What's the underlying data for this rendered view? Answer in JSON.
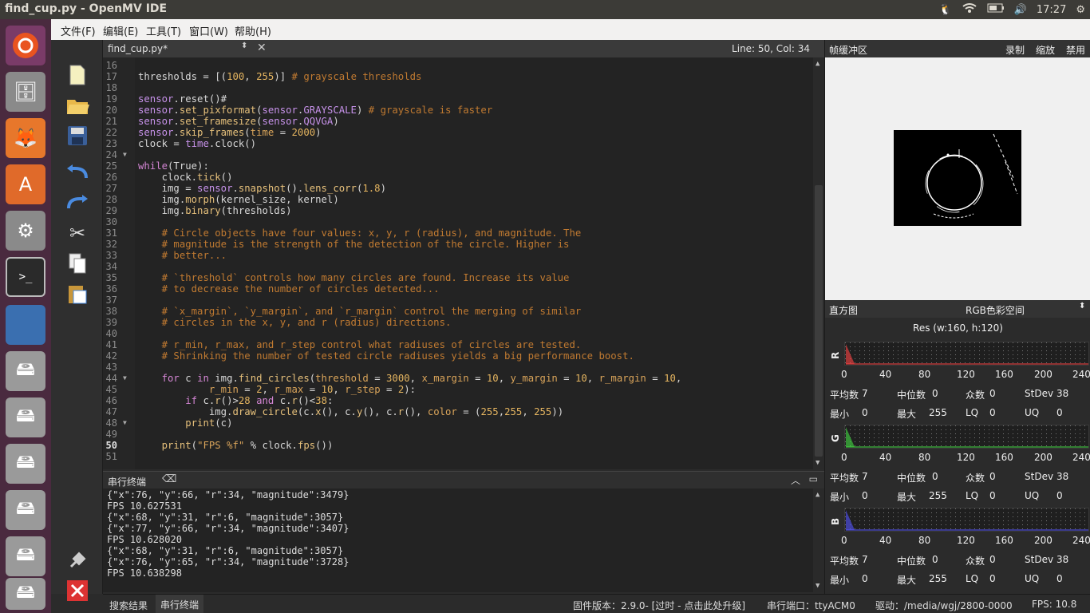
{
  "window": {
    "title": "find_cup.py - OpenMV IDE",
    "time": "17:27"
  },
  "menu": [
    "文件(F)",
    "编辑(E)",
    "工具(T)",
    "窗口(W)",
    "帮助(H)"
  ],
  "editor": {
    "tab": "find_cup.py*",
    "position": "Line: 50, Col: 34",
    "lines": [
      {
        "n": "16",
        "html": ""
      },
      {
        "n": "17",
        "html": "thresholds = [(<span class='num'>100</span>, <span class='num'>255</span>)] <span class='cm'># grayscale thresholds</span>"
      },
      {
        "n": "18",
        "html": ""
      },
      {
        "n": "19",
        "html": "<span class='nm'>sensor</span>.reset()#"
      },
      {
        "n": "20",
        "html": "<span class='nm'>sensor</span>.<span class='fn'>set_pixformat</span>(<span class='nm'>sensor</span>.<span class='nm'>GRAYSCALE</span>) <span class='cm'># grayscale is faster</span>"
      },
      {
        "n": "21",
        "html": "<span class='nm'>sensor</span>.<span class='fn'>set_framesize</span>(<span class='nm'>sensor</span>.<span class='nm'>QQVGA</span>)"
      },
      {
        "n": "22",
        "html": "<span class='nm'>sensor</span>.<span class='fn'>skip_frames</span>(<span class='st'>time</span> = <span class='num'>2000</span>)"
      },
      {
        "n": "23",
        "html": "clock = <span class='nm'>time</span>.clock()"
      },
      {
        "n": "24",
        "html": ""
      },
      {
        "n": "25",
        "html": "<span class='kw'>while</span>(True):"
      },
      {
        "n": "26",
        "html": "    clock.<span class='fn'>tick</span>()"
      },
      {
        "n": "27",
        "html": "    img = <span class='nm'>sensor</span>.<span class='fn'>snapshot</span>().<span class='fn'>lens_corr</span>(<span class='num'>1.8</span>)"
      },
      {
        "n": "28",
        "html": "    img.<span class='fn'>morph</span>(kernel_size, kernel)"
      },
      {
        "n": "29",
        "html": "    img.<span class='fn'>binary</span>(thresholds)"
      },
      {
        "n": "30",
        "html": ""
      },
      {
        "n": "31",
        "html": "    <span class='cm'># Circle objects have four values: x, y, r (radius), and magnitude. The</span>"
      },
      {
        "n": "32",
        "html": "    <span class='cm'># magnitude is the strength of the detection of the circle. Higher is</span>"
      },
      {
        "n": "33",
        "html": "    <span class='cm'># better...</span>"
      },
      {
        "n": "34",
        "html": ""
      },
      {
        "n": "35",
        "html": "    <span class='cm'># `threshold` controls how many circles are found. Increase its value</span>"
      },
      {
        "n": "36",
        "html": "    <span class='cm'># to decrease the number of circles detected...</span>"
      },
      {
        "n": "37",
        "html": ""
      },
      {
        "n": "38",
        "html": "    <span class='cm'># `x_margin`, `y_margin`, and `r_margin` control the merging of similar</span>"
      },
      {
        "n": "39",
        "html": "    <span class='cm'># circles in the x, y, and r (radius) directions.</span>"
      },
      {
        "n": "40",
        "html": ""
      },
      {
        "n": "41",
        "html": "    <span class='cm'># r_min, r_max, and r_step control what radiuses of circles are tested.</span>"
      },
      {
        "n": "42",
        "html": "    <span class='cm'># Shrinking the number of tested circle radiuses yields a big performance boost.</span>"
      },
      {
        "n": "43",
        "html": ""
      },
      {
        "n": "44",
        "html": "    <span class='kw'>for</span> c <span class='kw'>in</span> img.<span class='fn'>find_circles</span>(<span class='st'>threshold</span> = <span class='num'>3000</span>, <span class='st'>x_margin</span> = <span class='num'>10</span>, <span class='st'>y_margin</span> = <span class='num'>10</span>, <span class='st'>r_margin</span> = <span class='num'>10</span>,"
      },
      {
        "n": "45",
        "html": "            <span class='st'>r_min</span> = <span class='num'>2</span>, <span class='st'>r_max</span> = <span class='num'>10</span>, <span class='st'>r_step</span> = <span class='num'>2</span>):"
      },
      {
        "n": "46",
        "html": "        <span class='kw'>if</span> c.<span class='fn'>r</span>()&gt;<span class='num'>28</span> <span class='kw'>and</span> c.<span class='fn'>r</span>()&lt;<span class='num'>38</span>:"
      },
      {
        "n": "47",
        "html": "            img.<span class='fn'>draw_circle</span>(c.<span class='fn'>x</span>(), c.<span class='fn'>y</span>(), c.<span class='fn'>r</span>(), <span class='st'>color</span> = (<span class='num'>255</span>,<span class='num'>255</span>, <span class='num'>255</span>))"
      },
      {
        "n": "48",
        "html": "        <span class='fn'>print</span>(c)"
      },
      {
        "n": "49",
        "html": ""
      },
      {
        "n": "50",
        "html": "    <span class='fn'>print</span>(<span class='st'>\"FPS %f\"</span> % clock.<span class='fn'>fps</span>())"
      },
      {
        "n": "51",
        "html": ""
      }
    ]
  },
  "terminal": {
    "title": "串行终端",
    "lines": [
      "{\"x\":76, \"y\":66, \"r\":34, \"magnitude\":3479}",
      "FPS 10.627531",
      "{\"x\":68, \"y\":31, \"r\":6, \"magnitude\":3057}",
      "{\"x\":77, \"y\":66, \"r\":34, \"magnitude\":3407}",
      "FPS 10.628020",
      "{\"x\":68, \"y\":31, \"r\":6, \"magnitude\":3057}",
      "{\"x\":76, \"y\":65, \"r\":34, \"magnitude\":3728}",
      "FPS 10.638298"
    ]
  },
  "framebuffer": {
    "title": "帧缓冲区",
    "record": "录制",
    "zoom": "缩放",
    "disable": "禁用"
  },
  "histogram": {
    "title": "直方图",
    "colorspace": "RGB色彩空间",
    "res": "Res (w:160, h:120)",
    "ticks": [
      "0",
      "40",
      "80",
      "120",
      "160",
      "200",
      "240"
    ],
    "labels": {
      "mean": "平均数",
      "median": "中位数",
      "mode": "众数",
      "stdev": "StDev",
      "min": "最小",
      "max": "最大",
      "lq": "LQ",
      "uq": "UQ"
    },
    "channels": [
      {
        "name": "R",
        "color": "#ff4444",
        "mean": "7",
        "median": "0",
        "mode": "0",
        "stdev": "38",
        "min": "0",
        "max": "255",
        "lq": "0",
        "uq": "0"
      },
      {
        "name": "G",
        "color": "#44dd44",
        "mean": "7",
        "median": "0",
        "mode": "0",
        "stdev": "38",
        "min": "0",
        "max": "255",
        "lq": "0",
        "uq": "0"
      },
      {
        "name": "B",
        "color": "#5555ff",
        "mean": "7",
        "median": "0",
        "mode": "0",
        "stdev": "38",
        "min": "0",
        "max": "255",
        "lq": "0",
        "uq": "0"
      }
    ]
  },
  "status": {
    "search": "搜索结果",
    "serial_tab": "串行终端",
    "firmware": "固件版本：2.9.0- [过时 - 点击此处升级]",
    "port": "串行端口：ttyACM0",
    "drive": "驱动：/media/wgj/2800-0000",
    "fps": "FPS:  10.8"
  }
}
